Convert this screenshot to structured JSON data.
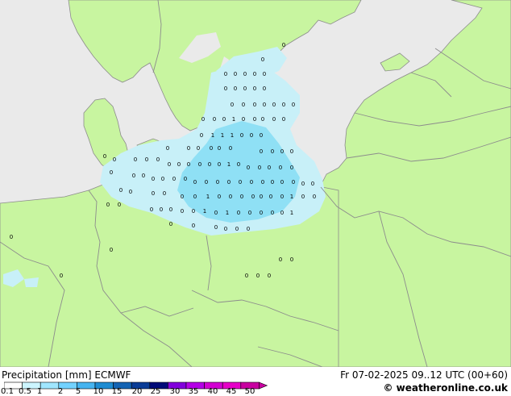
{
  "map": {
    "land_color": "#c8f5a0",
    "sea_color": "#eaeaea",
    "border_color": "#8c8c8c",
    "precip_light_color": "#c8f0f8",
    "precip_color": "#8fe0f5",
    "cell_labels": [
      "0",
      "1"
    ]
  },
  "legend": {
    "title": "Precipitation [mm]  ECMWF",
    "ticks": [
      "0.1",
      "0.5",
      "1",
      "2",
      "5",
      "10",
      "15",
      "20",
      "25",
      "30",
      "35",
      "40",
      "45",
      "50"
    ],
    "colors": [
      "#ffffff",
      "#ccf5ff",
      "#a0e6ff",
      "#73d2ff",
      "#46b4f0",
      "#1e8cd2",
      "#1464b4",
      "#0a3c96",
      "#000a78",
      "#8200dc",
      "#b400e6",
      "#d200d2",
      "#e600c8",
      "#c800a0"
    ]
  },
  "footer": {
    "timestamp": "Fr 07-02-2025 09..12 UTC (00+60)",
    "credit": "© weatheronline.co.uk"
  }
}
